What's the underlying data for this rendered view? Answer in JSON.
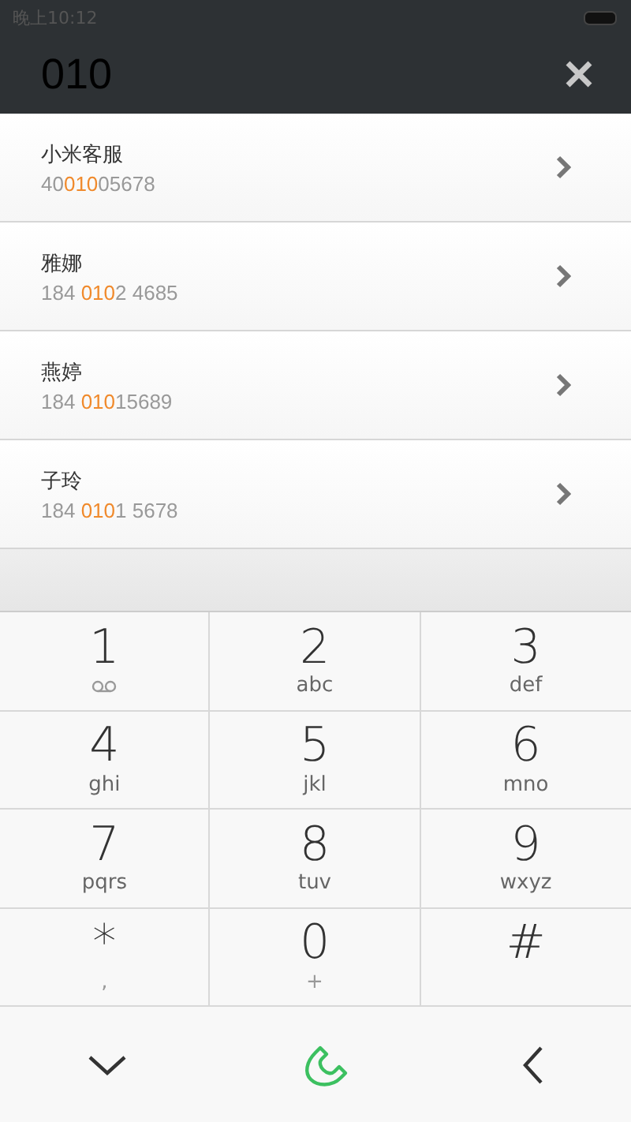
{
  "status_bar": {
    "time": "晚上10:12"
  },
  "search": {
    "value": "010"
  },
  "contacts": [
    {
      "name": "小米客服",
      "number": {
        "before": "40",
        "match": "010",
        "after": "05678"
      }
    },
    {
      "name": "雅娜",
      "number": {
        "before": "184 ",
        "match": "010",
        "after": "2 4685"
      }
    },
    {
      "name": "燕婷",
      "number": {
        "before": "184 ",
        "match": "010",
        "after": "15689"
      }
    },
    {
      "name": "子玲",
      "number": {
        "before": "184 ",
        "match": "010",
        "after": "1 5678"
      }
    }
  ],
  "keypad": [
    {
      "digit": "1",
      "kind": "voicemail"
    },
    {
      "digit": "2",
      "letters": "abc"
    },
    {
      "digit": "3",
      "letters": "def"
    },
    {
      "digit": "4",
      "letters": "ghi"
    },
    {
      "digit": "5",
      "letters": "jkl"
    },
    {
      "digit": "6",
      "letters": "mno"
    },
    {
      "digit": "7",
      "letters": "pqrs"
    },
    {
      "digit": "8",
      "letters": "tuv"
    },
    {
      "digit": "9",
      "letters": "wxyz"
    },
    {
      "digit": "*",
      "letters": ","
    },
    {
      "digit": "0",
      "letters": "+"
    },
    {
      "digit": "#"
    }
  ]
}
